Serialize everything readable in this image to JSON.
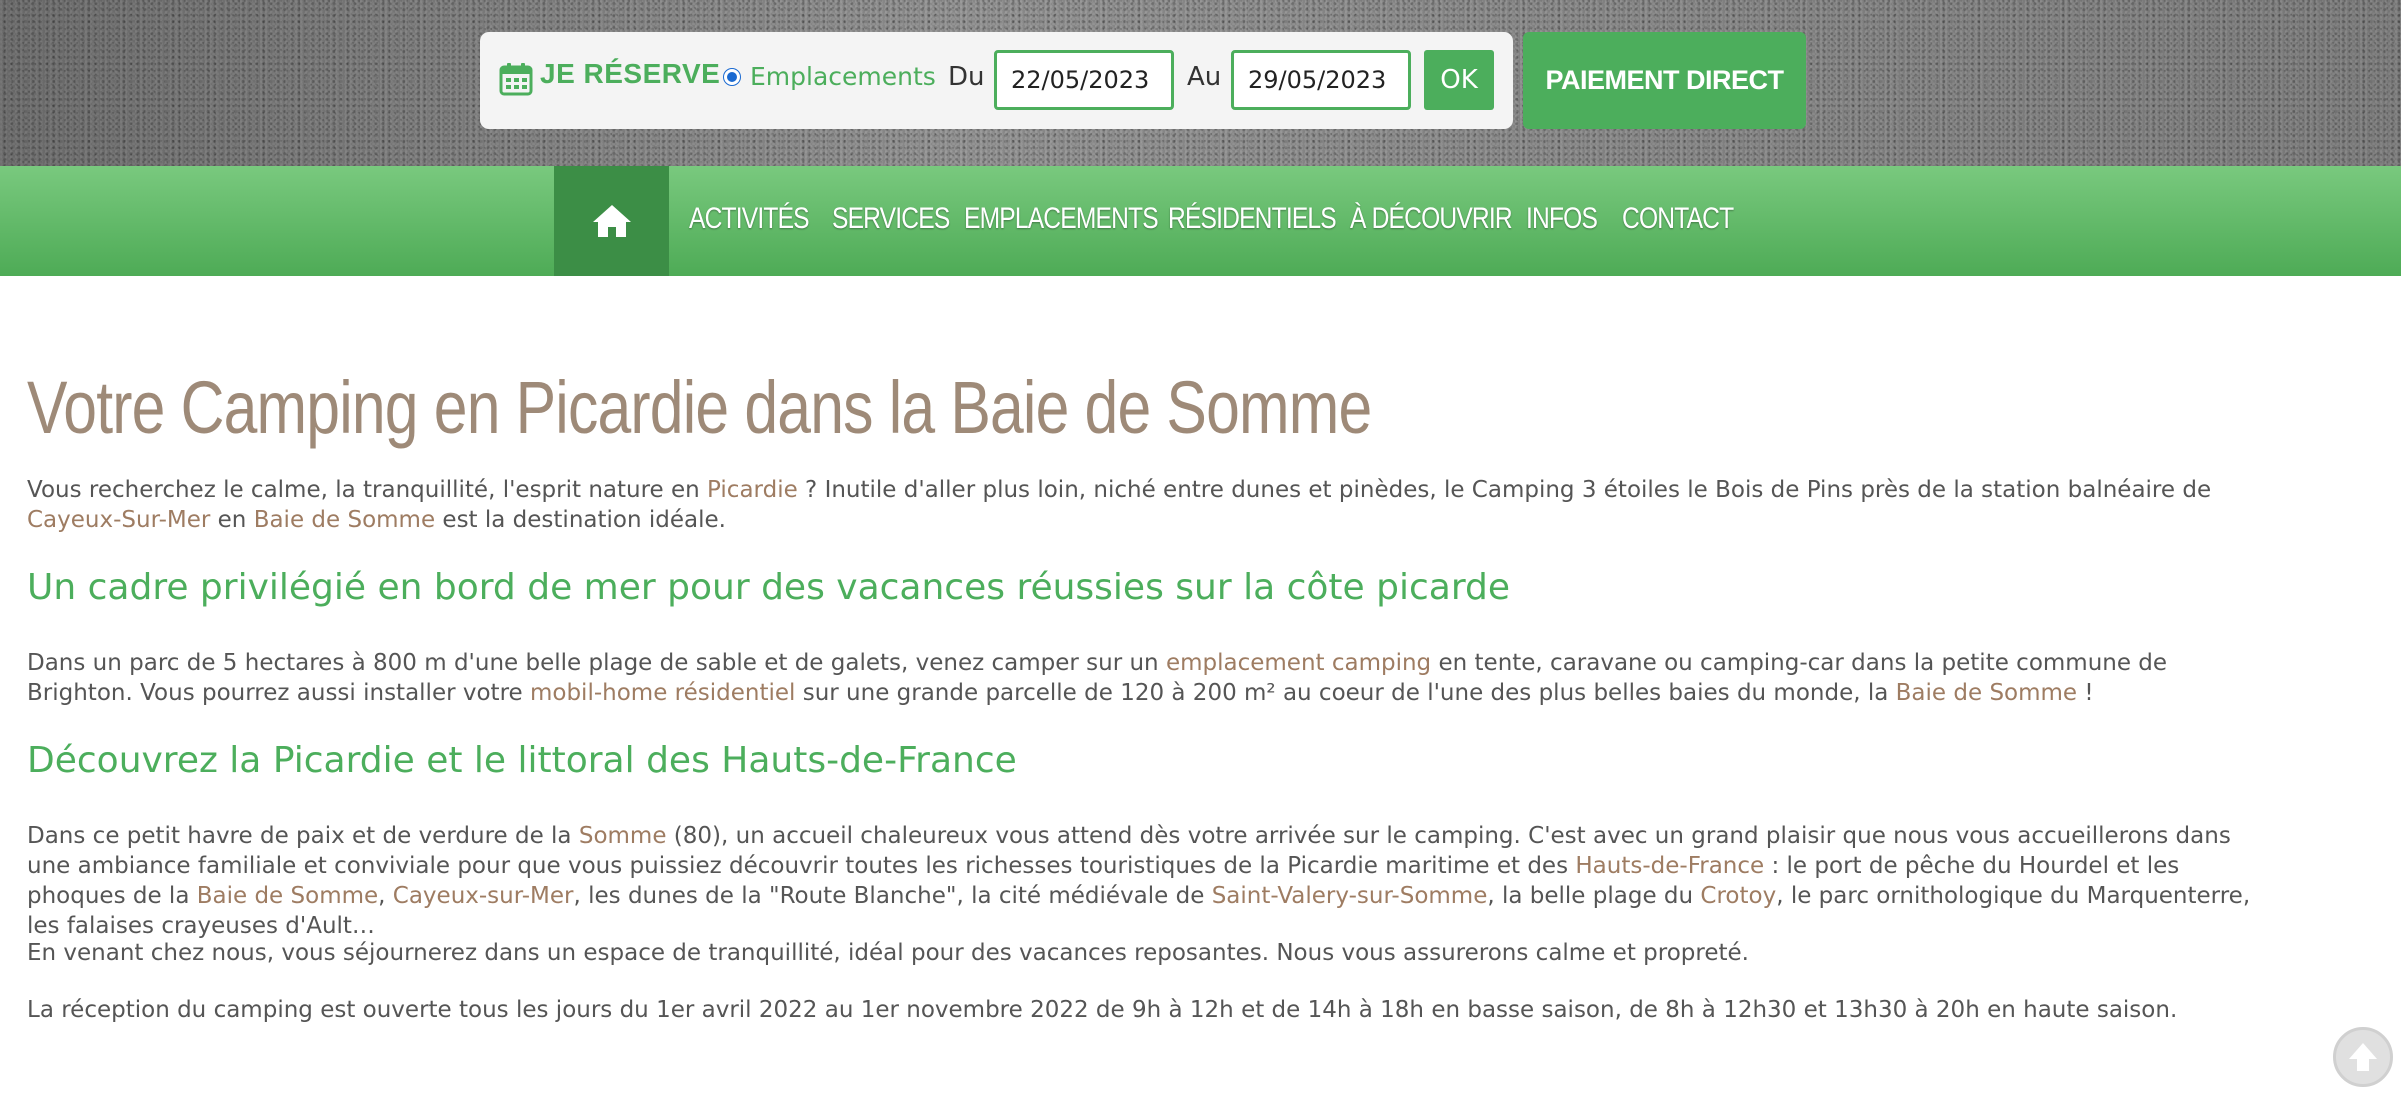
{
  "booking": {
    "reserve_label": "JE RÉSERVE",
    "radio_label": "Emplacements",
    "radio_checked": true,
    "from_label": "Du",
    "from_date": "22/05/2023",
    "to_label": "Au",
    "to_date": "29/05/2023",
    "ok_label": "OK",
    "pay_label": "PAIEMENT DIRECT"
  },
  "nav": {
    "home_icon": "home-icon",
    "items": [
      "ACTIVITÉS",
      "SERVICES",
      "EMPLACEMENTS",
      "RÉSIDENTIELS",
      "À DÉCOUVRIR",
      "INFOS",
      "CONTACT"
    ]
  },
  "content": {
    "title": "Votre Camping en Picardie dans la Baie de Somme",
    "p1": {
      "t1": "Vous recherchez le calme, la tranquillité, l'esprit nature en ",
      "l1": "Picardie",
      "t2": " ? Inutile d'aller plus loin, niché entre dunes et pinèdes, le Camping 3 étoiles le Bois de Pins près de la station balnéaire de ",
      "l2": "Cayeux-Sur-Mer",
      "t3": " en ",
      "l3": "Baie de Somme",
      "t4": " est la destination idéale."
    },
    "h2a": "Un cadre privilégié en bord de mer pour des vacances réussies sur la côte picarde",
    "p2": {
      "t1": "Dans un parc de 5 hectares à 800 m d'une belle plage de sable et de galets, venez camper sur un ",
      "l1": "emplacement camping",
      "t2": " en tente, caravane ou camping-car dans la petite commune de Brighton. Vous pourrez aussi installer votre ",
      "l2": "mobil-home résidentiel",
      "t3": " sur une grande parcelle de 120 à 200 m² au coeur de l'une des plus belles baies du monde, la ",
      "l3": "Baie de Somme",
      "t4": " !"
    },
    "h2b": "Découvrez la Picardie et le littoral des Hauts-de-France",
    "p3": {
      "t1": "Dans ce petit havre de paix et de verdure de la ",
      "l1": "Somme",
      "t2": " (80), un accueil chaleureux vous attend dès votre arrivée sur le camping. C'est avec un grand plaisir que nous vous accueillerons dans une ambiance familiale et conviviale pour que vous puissiez découvrir toutes les richesses touristiques de la Picardie maritime et des ",
      "l2": "Hauts-de-France",
      "t3": " : le port de pêche du Hourdel et les phoques de la ",
      "l3": "Baie de Somme",
      "t4": ", ",
      "l4": "Cayeux-sur-Mer",
      "t5": ", les dunes de la \"Route Blanche\", la cité médiévale de ",
      "l5": "Saint-Valery-sur-Somme",
      "t6": ", la belle plage du ",
      "l6": "Crotoy",
      "t7": ", le parc ornithologique du Marquenterre, les falaises crayeuses d'Ault…"
    },
    "p4": "En venant chez nous, vous séjournerez dans un espace de tranquillité, idéal pour des vacances reposantes. Nous vous assurerons calme et propreté.",
    "p5": "La réception du camping est ouverte tous les jours du 1er avril 2022 au 1er novembre 2022 de 9h à 12h et de 14h à 18h en basse saison, de 8h à 12h30 et 13h30 à 20h en haute saison."
  },
  "scroll_top_icon": "arrow-up-icon",
  "colors": {
    "accent_green": "#4cae5c",
    "title_taupe": "#9e8a78",
    "link_brown": "#9e7c62"
  }
}
